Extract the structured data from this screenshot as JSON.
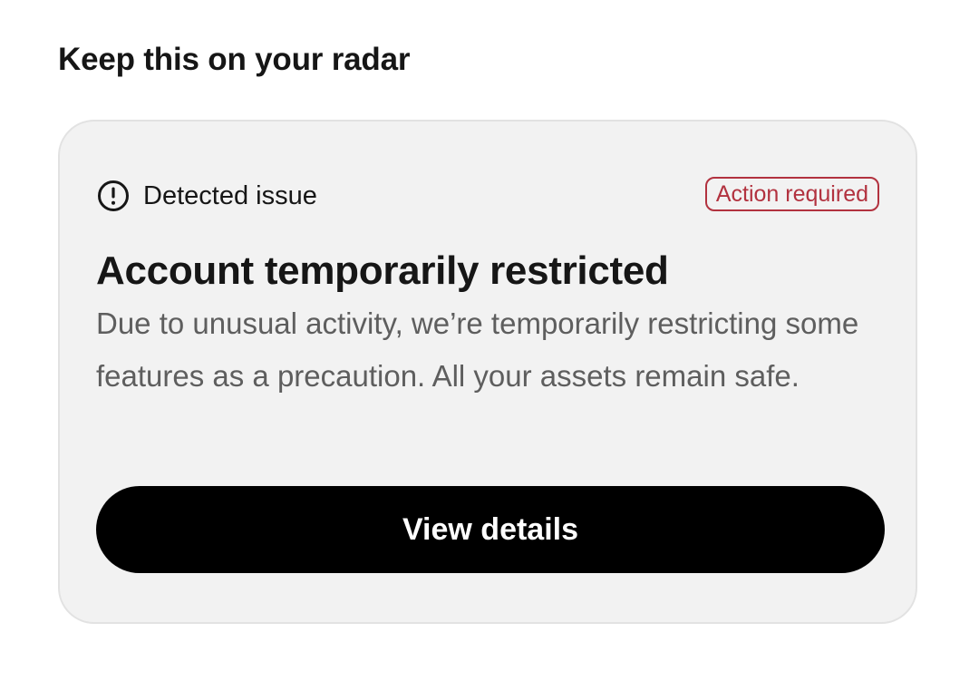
{
  "section": {
    "title": "Keep this on your radar"
  },
  "card": {
    "header": {
      "icon": "alert-circle-icon",
      "label": "Detected issue",
      "badge": "Action required",
      "badge_color": "#b2323f"
    },
    "title": "Account temporarily restricted",
    "body": "Due to unusual activity, we’re temporarily restricting some features as a precaution. All your assets remain safe.",
    "cta_label": "View details",
    "cta_color": "#000000",
    "background_color": "#f2f2f2"
  }
}
